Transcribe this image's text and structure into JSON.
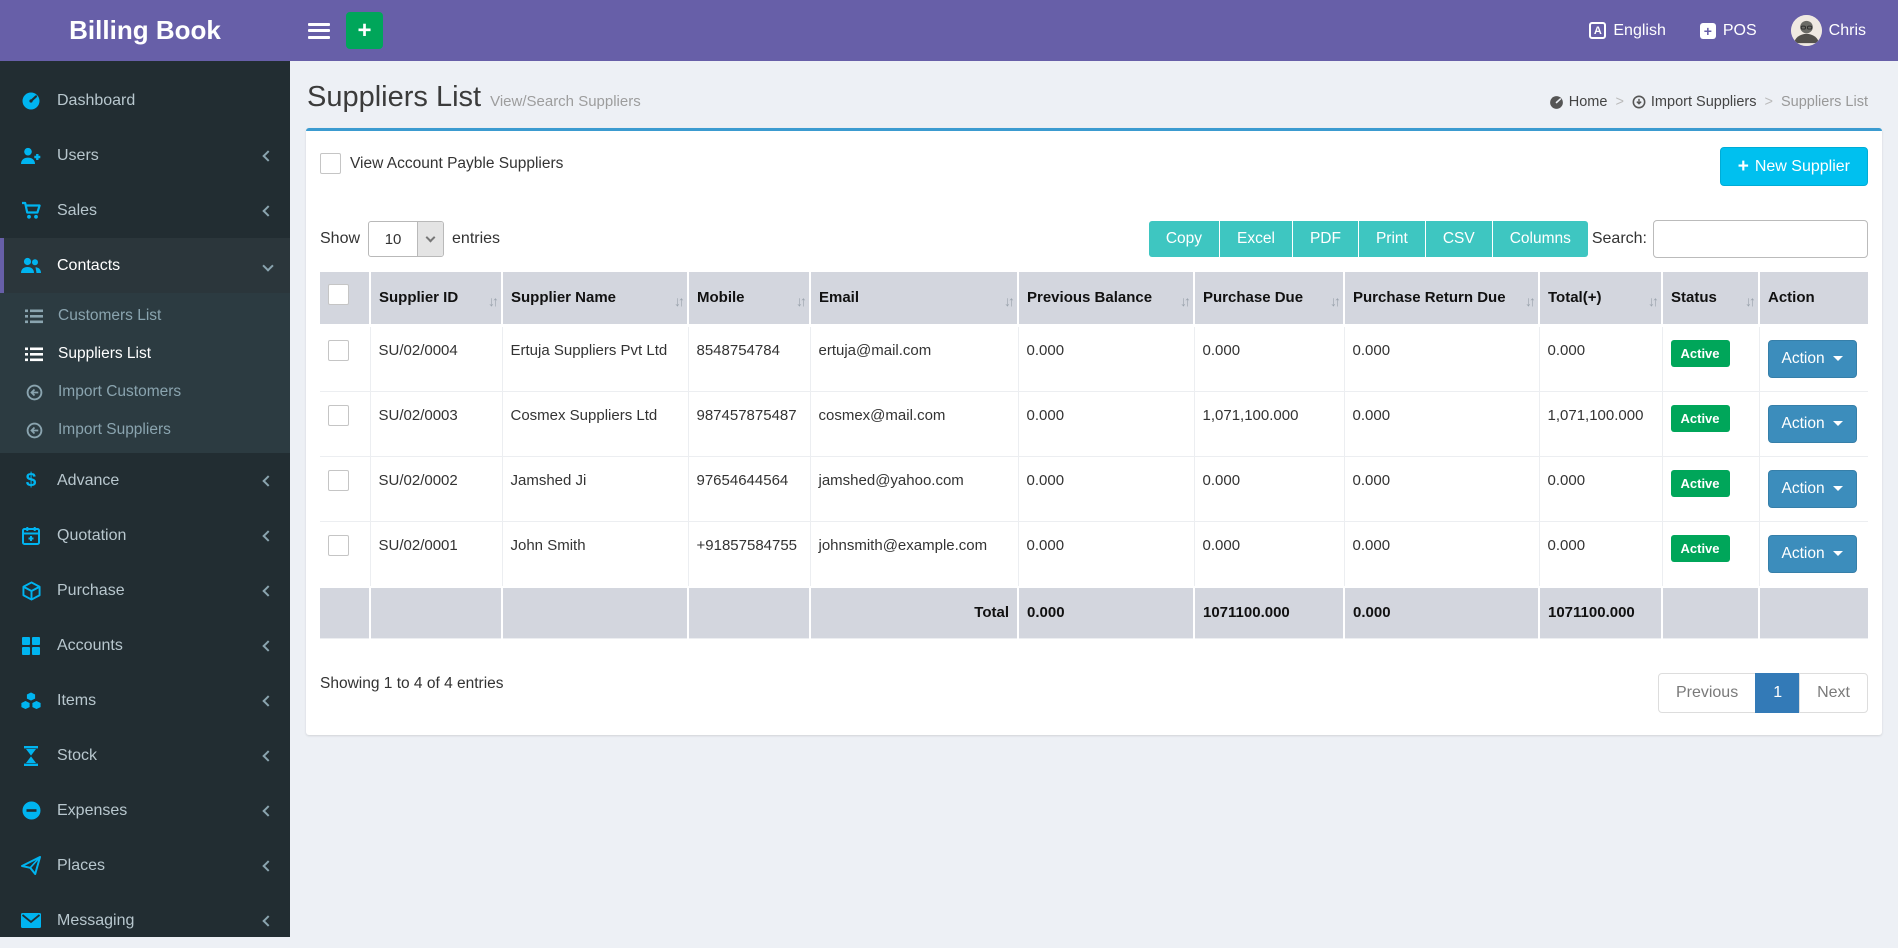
{
  "app": {
    "title": "Billing Book"
  },
  "navbar": {
    "language": "English",
    "pos": "POS",
    "user": "Chris"
  },
  "sidebar": {
    "items": [
      {
        "label": "Dashboard"
      },
      {
        "label": "Users"
      },
      {
        "label": "Sales"
      },
      {
        "label": "Contacts"
      },
      {
        "label": "Advance"
      },
      {
        "label": "Quotation"
      },
      {
        "label": "Purchase"
      },
      {
        "label": "Accounts"
      },
      {
        "label": "Items"
      },
      {
        "label": "Stock"
      },
      {
        "label": "Expenses"
      },
      {
        "label": "Places"
      },
      {
        "label": "Messaging"
      }
    ],
    "contacts_children": [
      {
        "label": "Customers List"
      },
      {
        "label": "Suppliers List"
      },
      {
        "label": "Import Customers"
      },
      {
        "label": "Import Suppliers"
      }
    ]
  },
  "page": {
    "title": "Suppliers List",
    "subtitle": "View/Search Suppliers",
    "breadcrumb": [
      {
        "label": "Home"
      },
      {
        "label": "Import Suppliers"
      },
      {
        "label": "Suppliers List"
      }
    ]
  },
  "toolbar": {
    "payble_checkbox_label": "View Account Payble Suppliers",
    "new_supplier_label": "New Supplier",
    "show_label": "Show",
    "page_length": "10",
    "entries_label": "entries",
    "export_buttons": [
      "Copy",
      "Excel",
      "PDF",
      "Print",
      "CSV",
      "Columns"
    ],
    "search_label": "Search:",
    "search_value": ""
  },
  "table": {
    "headers": [
      "Supplier ID",
      "Supplier Name",
      "Mobile",
      "Email",
      "Previous Balance",
      "Purchase Due",
      "Purchase Return Due",
      "Total(+)",
      "Status",
      "Action"
    ],
    "rows": [
      {
        "supplier_id": "SU/02/0004",
        "name": "Ertuja Suppliers Pvt Ltd",
        "mobile": "8548754784",
        "email": "ertuja@mail.com",
        "previous_balance": "0.000",
        "purchase_due": "0.000",
        "purchase_return_due": "0.000",
        "total": "0.000",
        "status": "Active",
        "action_label": "Action"
      },
      {
        "supplier_id": "SU/02/0003",
        "name": "Cosmex Suppliers Ltd",
        "mobile": "987457875487",
        "email": "cosmex@mail.com",
        "previous_balance": "0.000",
        "purchase_due": "1,071,100.000",
        "purchase_return_due": "0.000",
        "total": "1,071,100.000",
        "status": "Active",
        "action_label": "Action"
      },
      {
        "supplier_id": "SU/02/0002",
        "name": "Jamshed Ji",
        "mobile": "97654644564",
        "email": "jamshed@yahoo.com",
        "previous_balance": "0.000",
        "purchase_due": "0.000",
        "purchase_return_due": "0.000",
        "total": "0.000",
        "status": "Active",
        "action_label": "Action"
      },
      {
        "supplier_id": "SU/02/0001",
        "name": "John Smith",
        "mobile": "+91857584755",
        "email": "johnsmith@example.com",
        "previous_balance": "0.000",
        "purchase_due": "0.000",
        "purchase_return_due": "0.000",
        "total": "0.000",
        "status": "Active",
        "action_label": "Action"
      }
    ],
    "footer": {
      "label": "Total",
      "previous_balance": "0.000",
      "purchase_due": "1071100.000",
      "purchase_return_due": "0.000",
      "total": "1071100.000"
    },
    "info": "Showing 1 to 4 of 4 entries",
    "pagination": {
      "previous": "Previous",
      "page": "1",
      "next": "Next"
    }
  },
  "colors": {
    "topbar_purple": "#675fa8",
    "sidebar_dark": "#222d32",
    "sidebar_icon_cyan": "#00b4f0",
    "box_border_blue": "#3b9bd0",
    "new_supplier_cyan": "#00c0ef",
    "export_teal": "#3ec6c1",
    "status_green": "#00a65a",
    "action_blue": "#3c8dbc",
    "pagination_active_blue": "#337ab7",
    "table_header_grey": "#d3d6de"
  }
}
